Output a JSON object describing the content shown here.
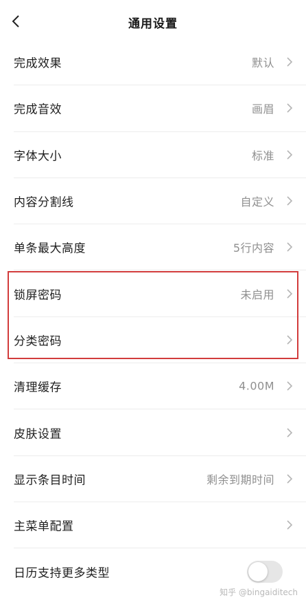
{
  "nav": {
    "title": "通用设置",
    "back_icon": "chevron-left-icon"
  },
  "settings": [
    {
      "label": "完成效果",
      "value": "默认"
    },
    {
      "label": "完成音效",
      "value": "画眉"
    },
    {
      "label": "字体大小",
      "value": "标准"
    },
    {
      "label": "内容分割线",
      "value": "自定义"
    },
    {
      "label": "单条最大高度",
      "value": "5行内容"
    },
    {
      "label": "锁屏密码",
      "value": "未启用"
    },
    {
      "label": "分类密码",
      "value": ""
    },
    {
      "label": "清理缓存",
      "value": "4.00M"
    },
    {
      "label": "皮肤设置",
      "value": ""
    },
    {
      "label": "显示条目时间",
      "value": "剩余到期时间"
    },
    {
      "label": "主菜单配置",
      "value": ""
    },
    {
      "label": "日历支持更多类型",
      "toggle": false
    }
  ],
  "highlight_color": "#d23b3b",
  "watermark": "知乎 @bingaiditech"
}
